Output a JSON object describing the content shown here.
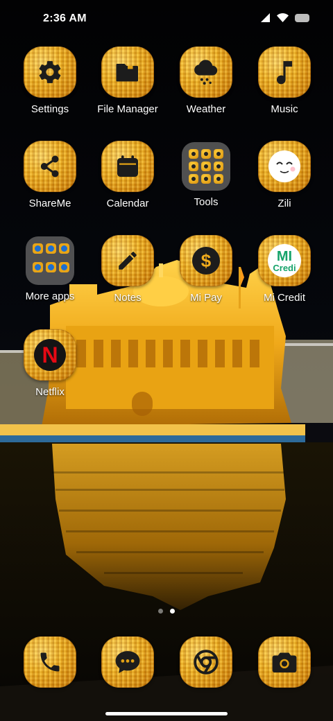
{
  "status_bar": {
    "time": "2:36 AM",
    "icons": [
      "signal-icon",
      "wifi-icon",
      "battery-icon"
    ]
  },
  "apps": [
    {
      "label": "Settings",
      "icon": "gear-icon"
    },
    {
      "label": "File Manager",
      "icon": "folder-icon"
    },
    {
      "label": "Weather",
      "icon": "cloud-rain-icon"
    },
    {
      "label": "Music",
      "icon": "music-note-icon"
    },
    {
      "label": "ShareMe",
      "icon": "share-icon"
    },
    {
      "label": "Calendar",
      "icon": "calendar-icon"
    },
    {
      "label": "Tools",
      "icon": "folder"
    },
    {
      "label": "Zili",
      "icon": "smiley-face-icon"
    },
    {
      "label": "More apps",
      "icon": "folder"
    },
    {
      "label": "Notes",
      "icon": "pencil-icon"
    },
    {
      "label": "Mi Pay",
      "icon": "dollar-icon"
    },
    {
      "label": "Mi Credit",
      "icon": "mi-credit-logo",
      "logo_text": "MI",
      "logo_subtext": "Credi"
    },
    {
      "label": "Netflix",
      "icon": "netflix-logo",
      "logo_text": "N"
    }
  ],
  "dock": [
    {
      "label": "",
      "icon": "phone-icon"
    },
    {
      "label": "",
      "icon": "messages-icon"
    },
    {
      "label": "",
      "icon": "chrome-icon"
    },
    {
      "label": "",
      "icon": "camera-icon"
    }
  ],
  "page_indicator": {
    "pages": 2,
    "current": 2
  },
  "colors": {
    "icon_gold": "#f3b320",
    "icon_gold_dark": "#b86d05",
    "label_text": "#ffffff",
    "netflix_red": "#e50914",
    "mi_green": "#16a36a"
  }
}
